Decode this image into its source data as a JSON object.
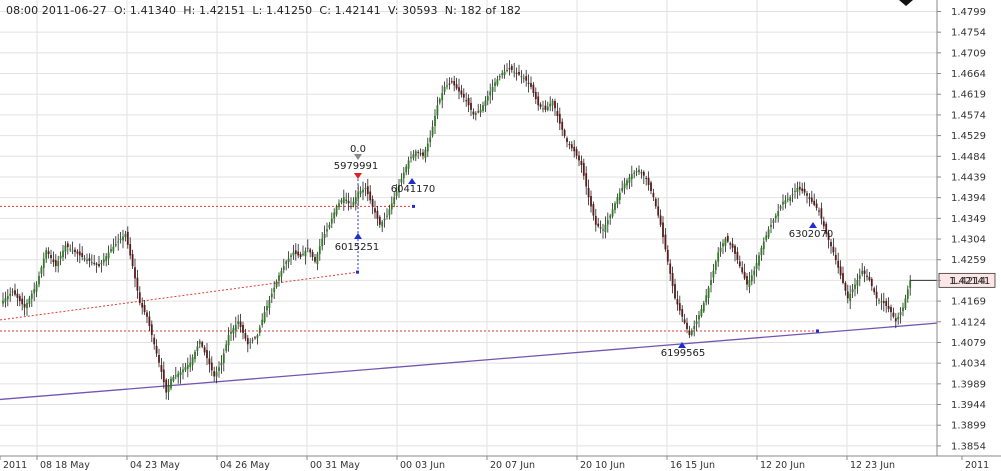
{
  "header": {
    "info_line": "08:00 2011-06-27  O: 1.41340  H: 1.42151  L: 1.41250  C: 1.42141  V: 30593  N: 182 of 182"
  },
  "colors": {
    "up": "#2e7d24",
    "down": "#5a1a1a",
    "grid": "#e2e2e2",
    "red_line": "#e53935",
    "blue_marker": "#1f2ecc",
    "trendline": "#7355b3",
    "axis": "#888888"
  },
  "chart_data": {
    "type": "candlestick",
    "ylim": [
      1.3832,
      1.4824
    ],
    "y_ticks": [
      "1.4799",
      "1.4754",
      "1.4709",
      "1.4664",
      "1.4619",
      "1.4574",
      "1.4529",
      "1.4484",
      "1.4439",
      "1.4394",
      "1.4349",
      "1.4304",
      "1.4259",
      "1.4214",
      "1.4169",
      "1.4124",
      "1.4079",
      "1.4034",
      "1.3989",
      "1.3944",
      "1.3899",
      "1.3854"
    ],
    "x_labels": [
      "2011",
      "08 18 May",
      "04 23 May",
      "04 26 May",
      "00 31 May",
      "00 03 Jun",
      "20 07 Jun",
      "20 10 Jun",
      "16 15 Jun",
      "12 20 Jun",
      "12 23 Jun",
      "2011"
    ],
    "last_price": "1.42141",
    "annotations": [
      {
        "text": "0.0",
        "kind": "label"
      },
      {
        "text": "5979991",
        "kind": "down-marker"
      },
      {
        "text": "6015251",
        "kind": "up-marker"
      },
      {
        "text": "6041170",
        "kind": "up-marker"
      },
      {
        "text": "6199565",
        "kind": "up-marker"
      },
      {
        "text": "6302070",
        "kind": "up-marker"
      }
    ],
    "price_path": [
      [
        0,
        1.417
      ],
      [
        4,
        1.419
      ],
      [
        9,
        1.4155
      ],
      [
        14,
        1.4205
      ],
      [
        18,
        1.428
      ],
      [
        22,
        1.4245
      ],
      [
        26,
        1.429
      ],
      [
        33,
        1.4265
      ],
      [
        40,
        1.4245
      ],
      [
        45,
        1.4282
      ],
      [
        51,
        1.4315
      ],
      [
        54,
        1.4245
      ],
      [
        57,
        1.4165
      ],
      [
        60,
        1.4135
      ],
      [
        63,
        1.4075
      ],
      [
        66,
        1.4015
      ],
      [
        68,
        1.397
      ],
      [
        70,
        1.4
      ],
      [
        74,
        1.4015
      ],
      [
        78,
        1.4035
      ],
      [
        82,
        1.4082
      ],
      [
        85,
        1.4045
      ],
      [
        88,
        1.4005
      ],
      [
        91,
        1.4035
      ],
      [
        94,
        1.4095
      ],
      [
        98,
        1.4125
      ],
      [
        102,
        1.4075
      ],
      [
        106,
        1.4095
      ],
      [
        109,
        1.4145
      ],
      [
        112,
        1.4185
      ],
      [
        115,
        1.4225
      ],
      [
        118,
        1.4255
      ],
      [
        121,
        1.4275
      ],
      [
        124,
        1.4265
      ],
      [
        127,
        1.4285
      ],
      [
        130,
        1.4255
      ],
      [
        133,
        1.4305
      ],
      [
        136,
        1.4335
      ],
      [
        139,
        1.4375
      ],
      [
        142,
        1.4395
      ],
      [
        145,
        1.4375
      ],
      [
        148,
        1.4405
      ],
      [
        151,
        1.4415
      ],
      [
        154,
        1.4375
      ],
      [
        157,
        1.4335
      ],
      [
        160,
        1.4355
      ],
      [
        163,
        1.4395
      ],
      [
        166,
        1.4435
      ],
      [
        169,
        1.4475
      ],
      [
        172,
        1.4495
      ],
      [
        175,
        1.4485
      ],
      [
        178,
        1.4525
      ],
      [
        181,
        1.4595
      ],
      [
        184,
        1.4635
      ],
      [
        187,
        1.4645
      ],
      [
        190,
        1.4625
      ],
      [
        193,
        1.4605
      ],
      [
        196,
        1.4575
      ],
      [
        199,
        1.4585
      ],
      [
        202,
        1.4615
      ],
      [
        205,
        1.4645
      ],
      [
        208,
        1.4665
      ],
      [
        211,
        1.4675
      ],
      [
        214,
        1.4665
      ],
      [
        217,
        1.4655
      ],
      [
        220,
        1.4635
      ],
      [
        223,
        1.4595
      ],
      [
        226,
        1.4585
      ],
      [
        229,
        1.4605
      ],
      [
        232,
        1.4555
      ],
      [
        235,
        1.4515
      ],
      [
        238,
        1.4495
      ],
      [
        241,
        1.4465
      ],
      [
        244,
        1.4395
      ],
      [
        247,
        1.4335
      ],
      [
        250,
        1.4325
      ],
      [
        253,
        1.4355
      ],
      [
        256,
        1.4395
      ],
      [
        259,
        1.4425
      ],
      [
        262,
        1.4445
      ],
      [
        265,
        1.4455
      ],
      [
        268,
        1.4435
      ],
      [
        271,
        1.4395
      ],
      [
        274,
        1.4335
      ],
      [
        277,
        1.4255
      ],
      [
        280,
        1.4175
      ],
      [
        283,
        1.4135
      ],
      [
        286,
        1.4095
      ],
      [
        289,
        1.4125
      ],
      [
        292,
        1.4165
      ],
      [
        295,
        1.4215
      ],
      [
        298,
        1.4275
      ],
      [
        301,
        1.4305
      ],
      [
        304,
        1.4285
      ],
      [
        307,
        1.4245
      ],
      [
        310,
        1.4205
      ],
      [
        313,
        1.4235
      ],
      [
        316,
        1.4285
      ],
      [
        319,
        1.4325
      ],
      [
        322,
        1.4355
      ],
      [
        325,
        1.4385
      ],
      [
        328,
        1.4395
      ],
      [
        331,
        1.4415
      ],
      [
        334,
        1.4405
      ],
      [
        337,
        1.4385
      ],
      [
        340,
        1.4365
      ],
      [
        343,
        1.4315
      ],
      [
        346,
        1.4275
      ],
      [
        349,
        1.4225
      ],
      [
        352,
        1.4175
      ],
      [
        355,
        1.4205
      ],
      [
        358,
        1.4235
      ],
      [
        361,
        1.4215
      ],
      [
        364,
        1.4175
      ],
      [
        367,
        1.4165
      ],
      [
        370,
        1.4145
      ],
      [
        372,
        1.4125
      ],
      [
        375,
        1.4155
      ],
      [
        378,
        1.4214
      ]
    ]
  }
}
